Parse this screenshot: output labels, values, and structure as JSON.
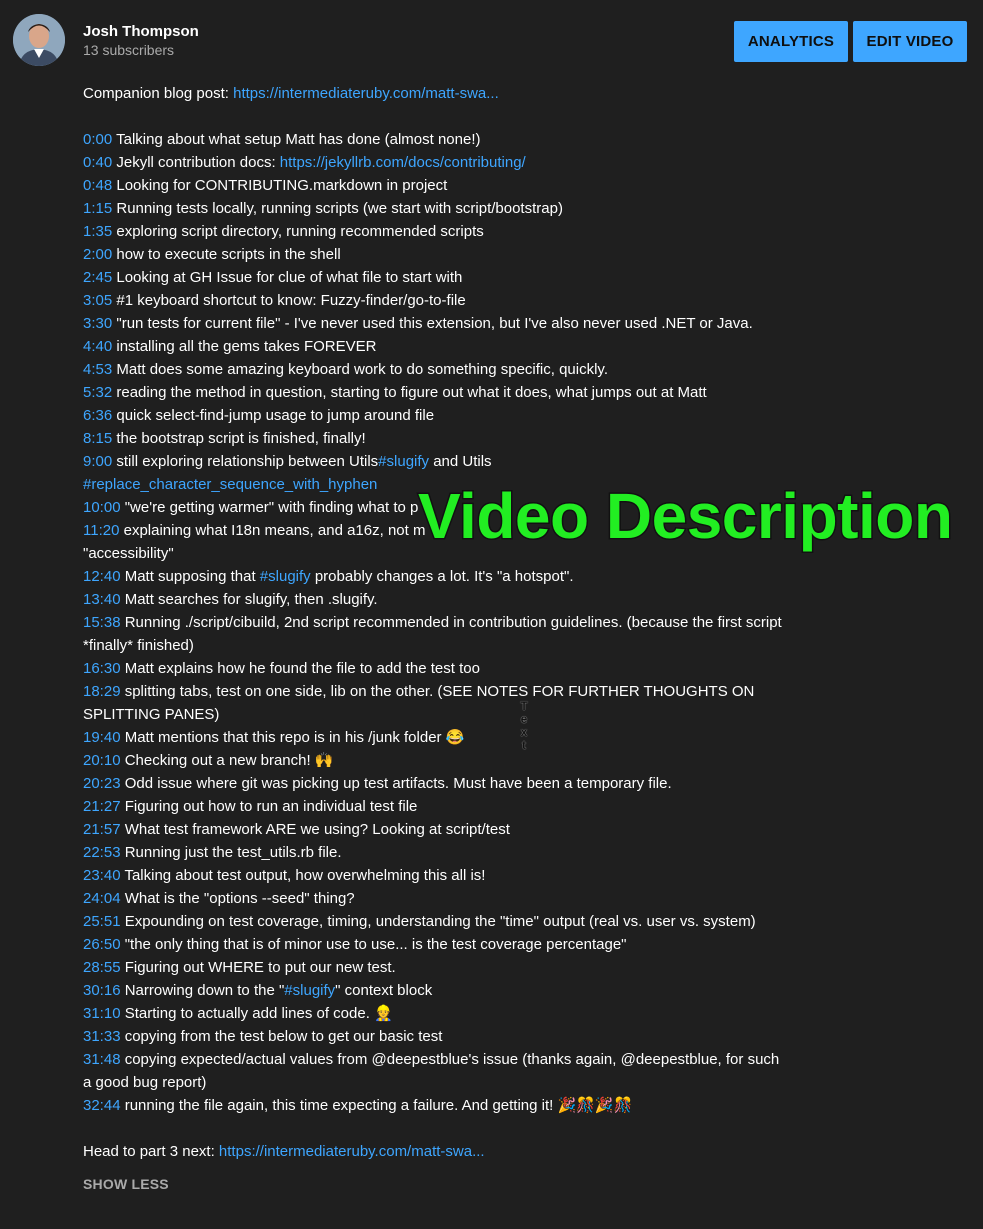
{
  "header": {
    "channel_name": "Josh Thompson",
    "subscribers": "13 subscribers",
    "analytics_label": "ANALYTICS",
    "edit_label": "EDIT VIDEO"
  },
  "description": {
    "companion_prefix": "Companion blog post:  ",
    "companion_link": "https://intermediateruby.com/matt-swa...",
    "timestamps": [
      {
        "time": "0:00",
        "text": " Talking about what setup Matt has done (almost none!)"
      },
      {
        "time": "0:40",
        "text": " Jekyll contribution docs: ",
        "link": "https://jekyllrb.com/docs/contributing/"
      },
      {
        "time": "0:48",
        "text": " Looking for CONTRIBUTING.markdown in project"
      },
      {
        "time": "1:15",
        "text": " Running tests locally, running scripts (we start with script/bootstrap)"
      },
      {
        "time": "1:35",
        "text": " exploring script directory, running recommended scripts"
      },
      {
        "time": "2:00",
        "text": " how to execute scripts in the shell"
      },
      {
        "time": "2:45",
        "text": " Looking at GH Issue for clue of what file to start with"
      },
      {
        "time": "3:05",
        "text": " #1 keyboard shortcut to know: Fuzzy-finder/go-to-file"
      },
      {
        "time": "3:30",
        "text": " \"run tests for current file\" - I've never used this extension, but I've also never used .NET or Java."
      },
      {
        "time": "4:40",
        "text": " installing all the gems takes FOREVER"
      },
      {
        "time": "4:53",
        "text": " Matt does some amazing keyboard work to do something specific, quickly."
      },
      {
        "time": "5:32",
        "text": " reading the method in question, starting to figure out what it does, what jumps out at Matt"
      },
      {
        "time": "6:36",
        "text": " quick select-find-jump usage to jump around file"
      },
      {
        "time": "8:15",
        "text": " the bootstrap script is finished, finally!"
      },
      {
        "time": "9:00",
        "text": " still exploring relationship between Utils",
        "hashtag": "#slugify",
        "text2": " and Utils",
        "hashtag2": "#replace_character_sequence_with_hyphen"
      },
      {
        "time": "10:00",
        "text": " \"we're getting warmer\" with finding what to p"
      },
      {
        "time": "11:20",
        "text": " explaining what I18n means, and a16z, not m",
        "continuation": "\"accessibility\""
      },
      {
        "time": "12:40",
        "text": " Matt supposing that ",
        "hashtag": "#slugify",
        "text2": " probably changes a lot. It's \"a hotspot\"."
      },
      {
        "time": "13:40",
        "text": " Matt searches for slugify, then .slugify."
      },
      {
        "time": "15:38",
        "text": " Running ./script/cibuild, 2nd script recommended in contribution guidelines. (because the first script *finally* finished)"
      },
      {
        "time": "16:30",
        "text": " Matt explains how he found the file to add the test too"
      },
      {
        "time": "18:29",
        "text": " splitting tabs, test on one side, lib on the other. (SEE NOTES FOR FURTHER THOUGHTS ON SPLITTING PANES)"
      },
      {
        "time": "19:40",
        "text": " Matt mentions that this repo is in his /junk folder  😂"
      },
      {
        "time": "20:10",
        "text": " Checking out a new branch! 🙌"
      },
      {
        "time": "20:23",
        "text": " Odd issue where git was picking up test artifacts. Must have been a temporary file."
      },
      {
        "time": "21:27",
        "text": " Figuring out how to run an individual test file"
      },
      {
        "time": "21:57",
        "text": " What test framework ARE we using? Looking at script/test"
      },
      {
        "time": "22:53",
        "text": " Running just the test_utils.rb file."
      },
      {
        "time": "23:40",
        "text": " Talking about test output, how overwhelming this all is!"
      },
      {
        "time": "24:04",
        "text": " What is the \"options --seed\" thing?"
      },
      {
        "time": "25:51",
        "text": " Expounding on test coverage, timing, understanding the \"time\" output (real vs. user vs. system)"
      },
      {
        "time": "26:50",
        "text": " \"the only thing that is of minor use to use... is the test coverage percentage\""
      },
      {
        "time": "28:55",
        "text": " Figuring out WHERE to put our new test."
      },
      {
        "time": "30:16",
        "text": " Narrowing down to the \"",
        "hashtag": "#slugify",
        "text2": "\" context block"
      },
      {
        "time": "31:10",
        "text": " Starting to actually add lines of code. 👷"
      },
      {
        "time": "31:33",
        "text": " copying from the test below to get our basic test"
      },
      {
        "time": "31:48",
        "text": " copying expected/actual values from @deepestblue's issue (thanks again, @deepestblue, for such a good bug report)"
      },
      {
        "time": "32:44",
        "text": " running the file again, this time expecting a failure. And getting it! 🎉🎊🎉🎊"
      }
    ],
    "part3_prefix": "Head to part 3 next: ",
    "part3_link": "https://intermediateruby.com/matt-swa...",
    "show_less": "SHOW LESS"
  },
  "overlay": {
    "title": "Video Description",
    "vertical_text": "Text"
  },
  "colors": {
    "background": "#1f1f1f",
    "accent": "#3ea6ff",
    "overlay_green": "#22ee22"
  }
}
